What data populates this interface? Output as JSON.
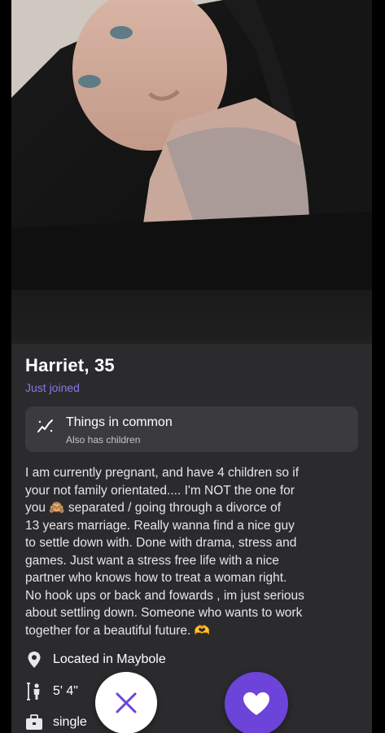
{
  "profile": {
    "name_age": "Harriet, 35",
    "status": "Just joined"
  },
  "things_in_common": {
    "title": "Things in common",
    "subtitle": "Also has children"
  },
  "bio": {
    "lines": [
      "I am currently pregnant, and have 4 children so if",
      "your not family orientated.... I'm NOT the one for",
      "you 🙈 separated / going through a divorce of",
      "13 years marriage. Really wanna find a nice guy",
      "to settle down with. Done with drama, stress and",
      "games. Just want a stress free life with a nice",
      "partner who knows how to treat a woman right.",
      "No hook ups or back and fowards , im just serious",
      "about settling down. Someone who wants to work",
      "together for a beautiful future. 🫶"
    ]
  },
  "details": {
    "location": "Located in Maybole",
    "height": "5' 4\"",
    "relationship": "single"
  },
  "icons": {
    "common": "trend-icon",
    "location": "location-pin-icon",
    "height": "height-icon",
    "relationship": "briefcase-icon",
    "pass": "close-icon",
    "like": "heart-icon"
  },
  "colors": {
    "accent": "#6c44d9",
    "status_text": "#8f74e6",
    "background": "#2b2b2e",
    "card": "#3b3b3f"
  }
}
